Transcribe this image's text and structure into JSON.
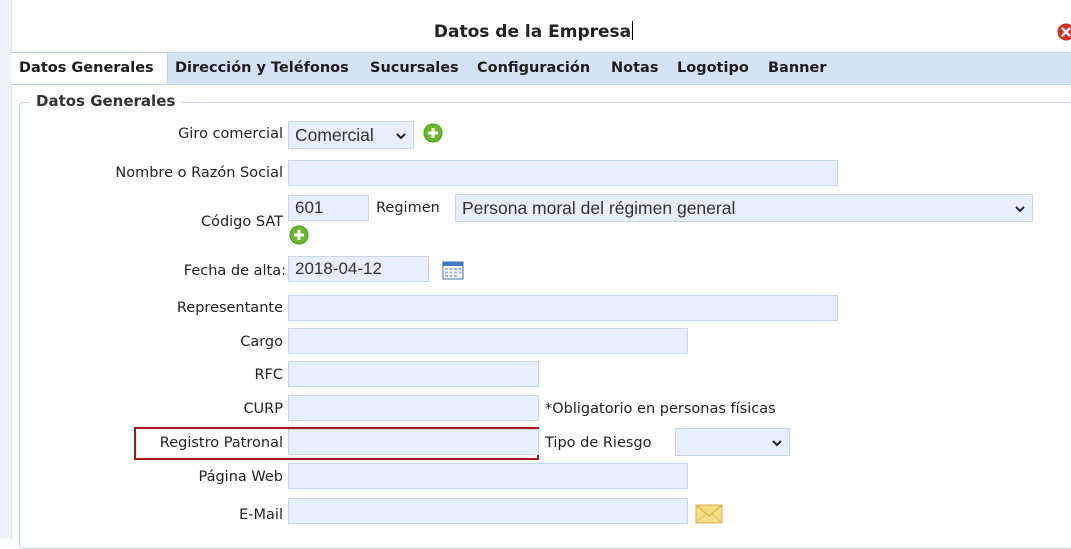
{
  "window": {
    "title": "Datos de la Empresa"
  },
  "tabs": [
    {
      "label": "Datos Generales",
      "active": true
    },
    {
      "label": "Dirección y Teléfonos",
      "active": false
    },
    {
      "label": "Sucursales",
      "active": false
    },
    {
      "label": "Configuración",
      "active": false
    },
    {
      "label": "Notas",
      "active": false
    },
    {
      "label": "Logotipo",
      "active": false
    },
    {
      "label": "Banner",
      "active": false
    }
  ],
  "section": {
    "legend": "Datos Generales"
  },
  "fields": {
    "giro": {
      "label": "Giro comercial",
      "value": "Comercial"
    },
    "nombre": {
      "label": "Nombre o Razón Social",
      "value": ""
    },
    "codigo_sat": {
      "label": "Código SAT",
      "value": "601"
    },
    "regimen": {
      "label": "Regimen",
      "value": "Persona moral del régimen general"
    },
    "fecha_alta": {
      "label": "Fecha de alta:",
      "value": "2018-04-12"
    },
    "representante": {
      "label": "Representante",
      "value": ""
    },
    "cargo": {
      "label": "Cargo",
      "value": ""
    },
    "rfc": {
      "label": "RFC",
      "value": ""
    },
    "curp": {
      "label": "CURP",
      "value": "",
      "note": "*Obligatorio en personas físicas"
    },
    "registro_patronal": {
      "label": "Registro Patronal",
      "value": ""
    },
    "tipo_riesgo": {
      "label": "Tipo de Riesgo",
      "value": ""
    },
    "pagina_web": {
      "label": "Página Web",
      "value": ""
    },
    "email": {
      "label": "E-Mail",
      "value": ""
    }
  },
  "colors": {
    "accent_red": "#a8191e",
    "tab_strip": "#d6e3f5",
    "input_bg": "#e6effb",
    "add_green": "#6ab82c",
    "close_red": "#d9281c"
  },
  "icons": [
    "close-icon",
    "add-icon",
    "calendar-icon",
    "mail-icon",
    "chevron-down-icon"
  ]
}
